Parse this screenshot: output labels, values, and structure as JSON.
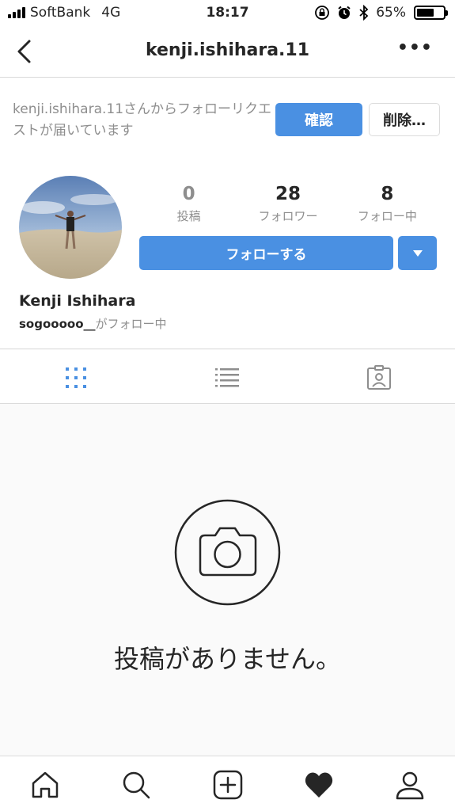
{
  "status_bar": {
    "carrier": "SoftBank",
    "network": "4G",
    "time": "18:17",
    "battery": "65%",
    "battery_level": 0.65,
    "icons": [
      "signal-icon",
      "orientation-lock-icon",
      "alarm-icon",
      "bluetooth-icon",
      "battery-icon"
    ]
  },
  "nav": {
    "title": "kenji.ishihara.11",
    "back_icon": "chevron-left-icon",
    "more_label": "•••"
  },
  "follow_request": {
    "text": "kenji.ishihara.11さんからフォローリクエストが届いています",
    "confirm_label": "確認",
    "delete_label": "削除…"
  },
  "profile": {
    "stats": [
      {
        "value": "0",
        "label": "投稿"
      },
      {
        "value": "28",
        "label": "フォロワー"
      },
      {
        "value": "8",
        "label": "フォロー中"
      }
    ],
    "follow_button_label": "フォローする",
    "name": "Kenji Ishihara",
    "followed_by_user": "sogooooo__",
    "followed_by_suffix": "がフォロー中"
  },
  "tabs": [
    {
      "icon": "grid-icon",
      "active": true
    },
    {
      "icon": "list-icon",
      "active": false
    },
    {
      "icon": "tagged-icon",
      "active": false
    }
  ],
  "empty_state": {
    "icon": "camera-icon",
    "text": "投稿がありません。"
  },
  "bottom_nav": [
    {
      "icon": "home-icon"
    },
    {
      "icon": "search-icon"
    },
    {
      "icon": "add-post-icon"
    },
    {
      "icon": "heart-icon"
    },
    {
      "icon": "profile-icon"
    }
  ],
  "colors": {
    "accent": "#4a90e2",
    "text": "#262626",
    "muted": "#8e8e8e",
    "border": "#dbdbdb"
  }
}
